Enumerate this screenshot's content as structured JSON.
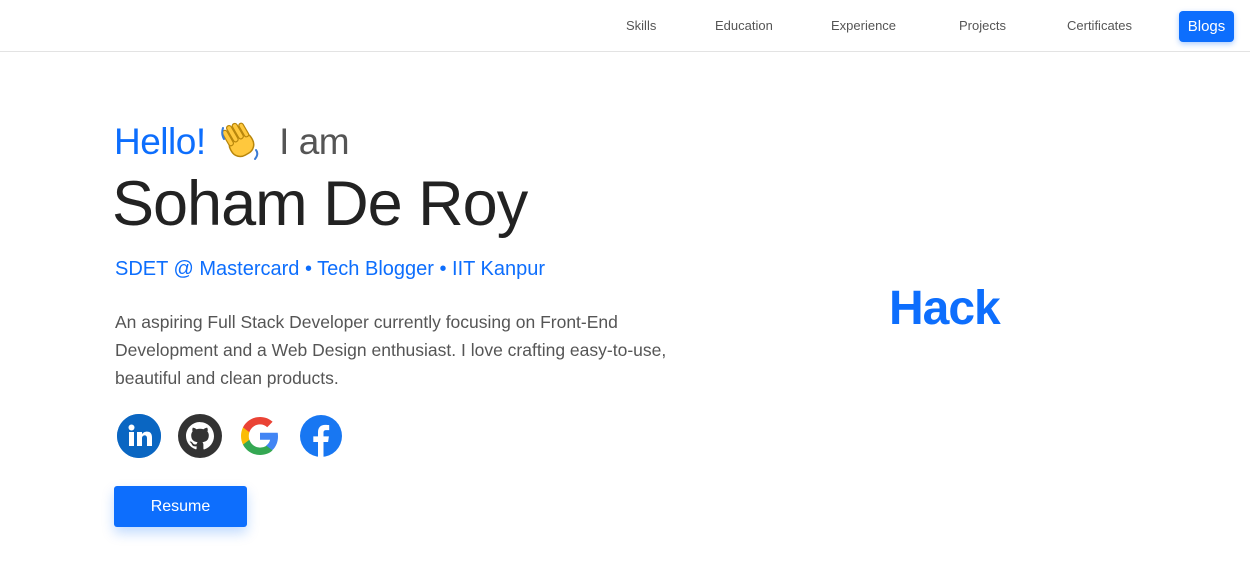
{
  "nav": {
    "items": [
      {
        "label": "Skills"
      },
      {
        "label": "Education"
      },
      {
        "label": "Experience"
      },
      {
        "label": "Projects"
      },
      {
        "label": "Certificates"
      }
    ],
    "blogs_label": "Blogs"
  },
  "hero": {
    "hello": "Hello!",
    "wave_icon": "waving-hand-icon",
    "iam": "I am",
    "name": "Soham De Roy",
    "tagline": "SDET @ Mastercard • Tech Blogger • IIT Kanpur",
    "bio": "An aspiring Full Stack Developer currently focusing on Front-End Development and a Web Design enthusiast. I love crafting easy-to-use, beautiful and clean products.",
    "socials": [
      {
        "icon": "linkedin-icon"
      },
      {
        "icon": "github-icon"
      },
      {
        "icon": "google-icon"
      },
      {
        "icon": "facebook-icon"
      }
    ],
    "resume_label": "Resume",
    "typing_text": "Hack"
  },
  "colors": {
    "accent": "#0d6efd",
    "linkedin": "#0a66c2",
    "github": "#333333",
    "facebook": "#1877f2"
  }
}
